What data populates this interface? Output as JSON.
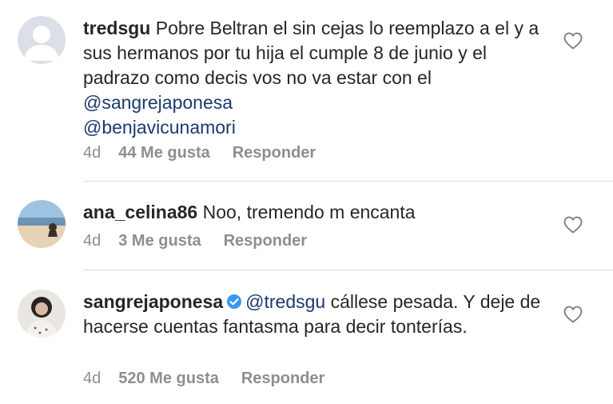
{
  "comments": [
    {
      "username": "tredsgu",
      "text_pre": " Pobre Beltran el sin cejas lo reemplazo a el y a sus hermanos por tu hija el cumple 8 de junio y el padrazo como decis vos no va estar con el ",
      "mention1": "@sangrejaponesa",
      "mention2": "@benjavicunamori",
      "time": "4d",
      "likes": "44 Me gusta",
      "reply": "Responder"
    },
    {
      "username": "ana_celina86",
      "text": " Noo, tremendo m encanta",
      "time": "4d",
      "likes": "3 Me gusta",
      "reply": "Responder"
    },
    {
      "username": "sangrejaponesa",
      "mention": "@tredsgu",
      "text": " cállese pesada. Y deje de hacerse cuentas fantasma para decir tonterías.",
      "time": "4d",
      "likes": "520 Me gusta",
      "reply": "Responder"
    }
  ],
  "colors": {
    "text": "#262626",
    "mention": "#1a3a6e",
    "meta": "#8e8e8e",
    "verified": "#3897f0"
  },
  "icons": {
    "like": "heart-outline-icon",
    "verified": "verified-badge-icon"
  }
}
